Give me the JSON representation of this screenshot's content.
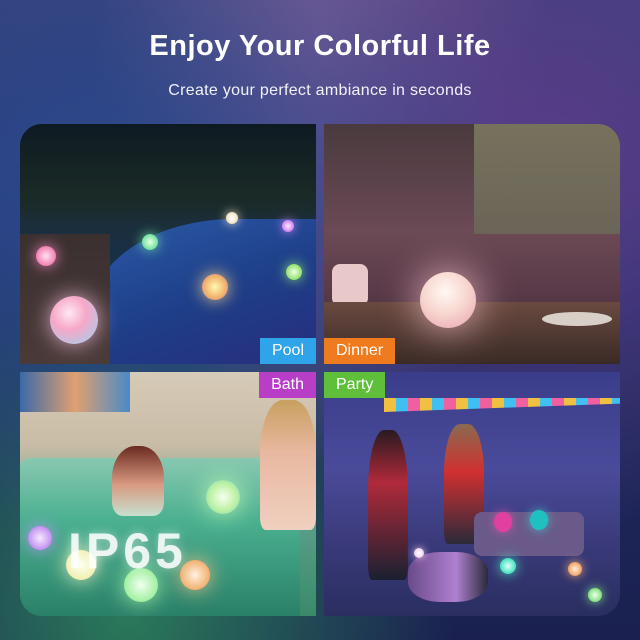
{
  "header": {
    "title": "Enjoy Your Colorful Life",
    "subtitle": "Create your perfect ambiance in seconds"
  },
  "panels": [
    {
      "id": "pool",
      "label": "Pool",
      "label_color": "#2fa4e8"
    },
    {
      "id": "dinner",
      "label": "Dinner",
      "label_color": "#f07a1e"
    },
    {
      "id": "bath",
      "label": "Bath",
      "label_color": "#b83ec8",
      "badge": "IP65"
    },
    {
      "id": "party",
      "label": "Party",
      "label_color": "#5fbf3a"
    }
  ]
}
